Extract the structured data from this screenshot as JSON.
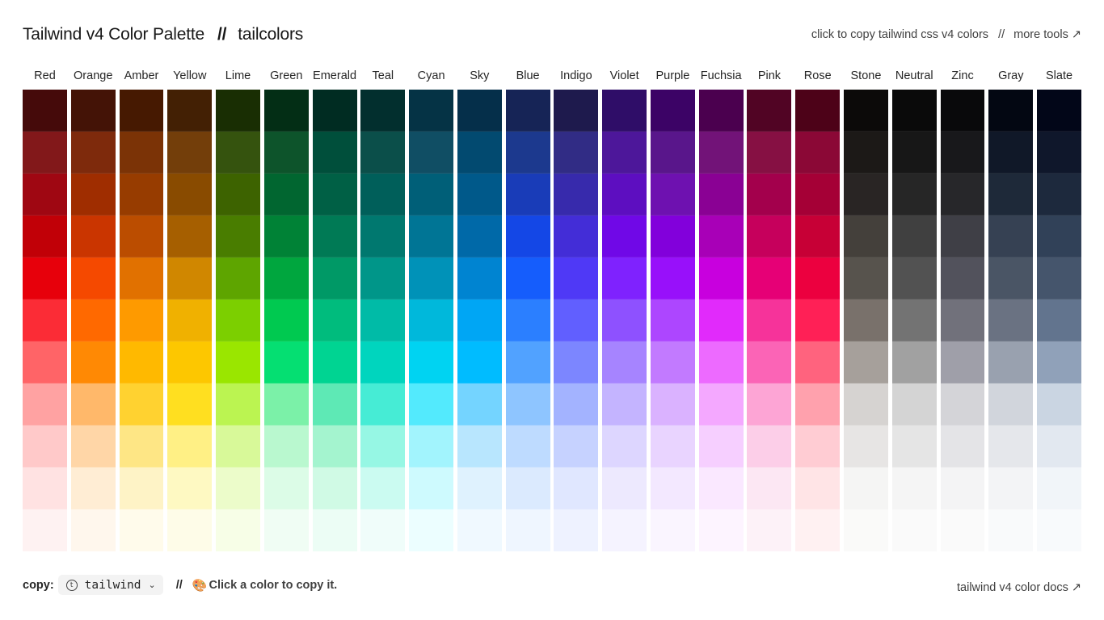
{
  "header": {
    "title": "Tailwind v4 Color Palette",
    "separator": "//",
    "brand": "tailcolors",
    "instruction": "click to copy tailwind css v4 colors",
    "right_separator": "//",
    "more_tools": "more tools ↗"
  },
  "palette": [
    {
      "name": "Red",
      "shades": [
        "#450a0a",
        "#82181a",
        "#9f0712",
        "#c10007",
        "#e7000b",
        "#fb2c36",
        "#ff6467",
        "#ffa2a2",
        "#ffc9c9",
        "#ffe2e2",
        "#fef2f2"
      ]
    },
    {
      "name": "Orange",
      "shades": [
        "#441306",
        "#7e2a0c",
        "#9f2d00",
        "#ca3500",
        "#f54900",
        "#ff6900",
        "#ff8904",
        "#ffb86a",
        "#ffd6a7",
        "#ffedd4",
        "#fff7ed"
      ]
    },
    {
      "name": "Amber",
      "shades": [
        "#461901",
        "#7b3306",
        "#973c00",
        "#bb4d00",
        "#e17100",
        "#fe9a00",
        "#ffb900",
        "#ffd230",
        "#fee685",
        "#fef3c6",
        "#fffbeb"
      ]
    },
    {
      "name": "Yellow",
      "shades": [
        "#432004",
        "#733e0a",
        "#894b00",
        "#a65f00",
        "#d08700",
        "#f0b100",
        "#fdc700",
        "#ffdf20",
        "#fff085",
        "#fef9c2",
        "#fefce8"
      ]
    },
    {
      "name": "Lime",
      "shades": [
        "#192e03",
        "#35530e",
        "#3d6300",
        "#497d00",
        "#5ea500",
        "#7ccf00",
        "#9ae600",
        "#bbf451",
        "#d8f999",
        "#ecfcca",
        "#f7fee7"
      ]
    },
    {
      "name": "Green",
      "shades": [
        "#032e15",
        "#0d542b",
        "#016630",
        "#008236",
        "#00a63e",
        "#00c950",
        "#05df72",
        "#7bf1a8",
        "#b9f8cf",
        "#dcfce7",
        "#f0fdf4"
      ]
    },
    {
      "name": "Emerald",
      "shades": [
        "#002c22",
        "#004f3b",
        "#006045",
        "#007a55",
        "#009966",
        "#00bc7d",
        "#00d492",
        "#5ee9b5",
        "#a4f4cf",
        "#d0fae5",
        "#ecfdf5"
      ]
    },
    {
      "name": "Teal",
      "shades": [
        "#022f2e",
        "#0b4f4a",
        "#005f5a",
        "#00786f",
        "#009689",
        "#00bba7",
        "#00d5be",
        "#46ecd5",
        "#96f7e4",
        "#cbfbf1",
        "#f0fdfa"
      ]
    },
    {
      "name": "Cyan",
      "shades": [
        "#053345",
        "#104e64",
        "#005f78",
        "#007595",
        "#0092b8",
        "#00b8db",
        "#00d3f2",
        "#53eafd",
        "#a2f4fd",
        "#cefafe",
        "#ecfeff"
      ]
    },
    {
      "name": "Sky",
      "shades": [
        "#052f4a",
        "#024a70",
        "#00598a",
        "#0069a8",
        "#0084d1",
        "#00a6f4",
        "#00bcff",
        "#74d4ff",
        "#b8e6fe",
        "#dff2fe",
        "#f0f9ff"
      ]
    },
    {
      "name": "Blue",
      "shades": [
        "#162456",
        "#1c398e",
        "#193cb8",
        "#1447e6",
        "#155dfc",
        "#2b7fff",
        "#51a2ff",
        "#8ec5ff",
        "#bedbff",
        "#dbeafe",
        "#eff6ff"
      ]
    },
    {
      "name": "Indigo",
      "shades": [
        "#1e1a4d",
        "#312c85",
        "#372aac",
        "#432dd7",
        "#4f39f6",
        "#615fff",
        "#7c86ff",
        "#a3b3ff",
        "#c6d2ff",
        "#e0e7ff",
        "#eef2ff"
      ]
    },
    {
      "name": "Violet",
      "shades": [
        "#2f0d68",
        "#4d179a",
        "#5d0ec0",
        "#7008e7",
        "#7f22fe",
        "#8e51ff",
        "#a684ff",
        "#c4b4ff",
        "#ddd6ff",
        "#ede9fe",
        "#f5f3ff"
      ]
    },
    {
      "name": "Purple",
      "shades": [
        "#3c0366",
        "#59168b",
        "#6e11b0",
        "#8200db",
        "#9810fa",
        "#ad46ff",
        "#c27aff",
        "#dab2ff",
        "#e9d4ff",
        "#f3e8ff",
        "#faf5ff"
      ]
    },
    {
      "name": "Fuchsia",
      "shades": [
        "#4b004f",
        "#721378",
        "#8a0194",
        "#a800b7",
        "#c800de",
        "#e12afb",
        "#ed6aff",
        "#f4a8ff",
        "#f6cfff",
        "#fae8ff",
        "#fdf4ff"
      ]
    },
    {
      "name": "Pink",
      "shades": [
        "#510424",
        "#861043",
        "#a3004c",
        "#c6005c",
        "#e60076",
        "#f6339a",
        "#fb64b6",
        "#fda5d5",
        "#fccee8",
        "#fce7f3",
        "#fdf2f8"
      ]
    },
    {
      "name": "Rose",
      "shades": [
        "#4d0218",
        "#8b0836",
        "#a50036",
        "#c70036",
        "#ec003f",
        "#ff2056",
        "#ff637e",
        "#ffa1ad",
        "#ffccd3",
        "#ffe4e6",
        "#fff1f2"
      ]
    },
    {
      "name": "Stone",
      "shades": [
        "#0c0a09",
        "#1c1917",
        "#292524",
        "#44403b",
        "#57534d",
        "#79716b",
        "#a6a09b",
        "#d6d3d1",
        "#e7e5e4",
        "#f5f5f4",
        "#fafaf9"
      ]
    },
    {
      "name": "Neutral",
      "shades": [
        "#0a0a0a",
        "#171717",
        "#262626",
        "#404040",
        "#525252",
        "#737373",
        "#a1a1a1",
        "#d4d4d4",
        "#e5e5e5",
        "#f5f5f5",
        "#fafafa"
      ]
    },
    {
      "name": "Zinc",
      "shades": [
        "#09090b",
        "#18181b",
        "#27272a",
        "#3f3f46",
        "#52525c",
        "#71717b",
        "#9f9fa9",
        "#d4d4d8",
        "#e4e4e7",
        "#f4f4f5",
        "#fafafa"
      ]
    },
    {
      "name": "Gray",
      "shades": [
        "#030712",
        "#101828",
        "#1e2939",
        "#364153",
        "#4a5565",
        "#6a7282",
        "#99a1af",
        "#d1d5dc",
        "#e5e7eb",
        "#f3f4f6",
        "#f9fafb"
      ]
    },
    {
      "name": "Slate",
      "shades": [
        "#020618",
        "#0f172b",
        "#1d293d",
        "#314158",
        "#45556c",
        "#62748e",
        "#90a1b9",
        "#cad5e2",
        "#e2e8f0",
        "#f1f5f9",
        "#f8fafc"
      ]
    }
  ],
  "footer": {
    "copy_label": "copy:",
    "format_icon": "tailwind-icon",
    "format_value": "tailwind",
    "separator": "//",
    "hint_icon": "🎨",
    "hint_text": "Click a color to copy it.",
    "docs_link": "tailwind v4 color docs ↗"
  }
}
